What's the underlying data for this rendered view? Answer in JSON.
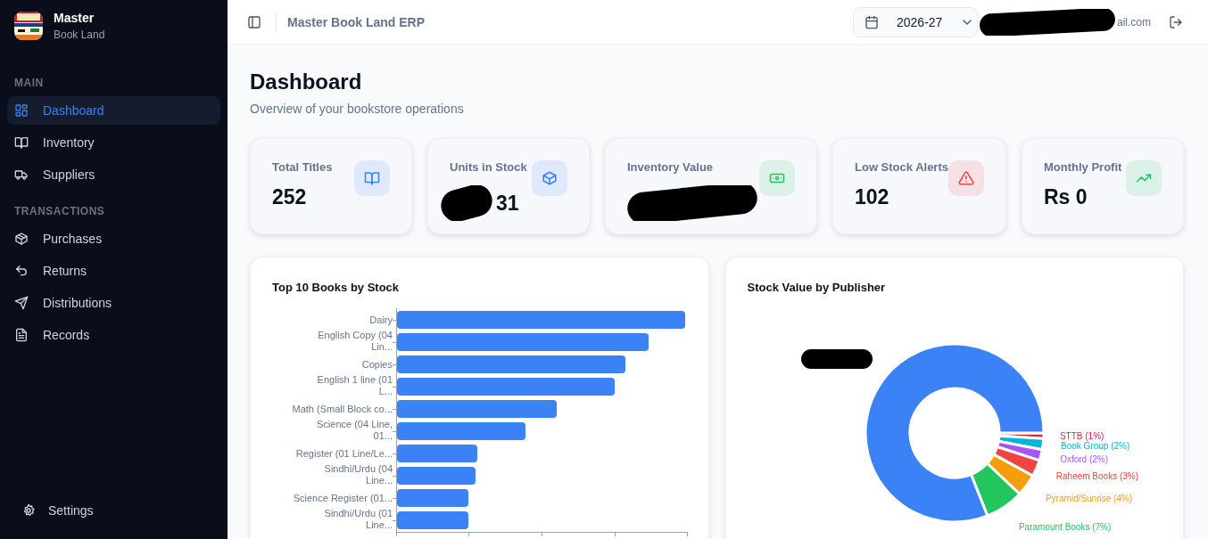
{
  "sidebar": {
    "brand": {
      "name": "Master",
      "subtitle": "Book Land"
    },
    "sections": [
      {
        "heading": "MAIN",
        "items": [
          {
            "label": "Dashboard",
            "selected": true
          },
          {
            "label": "Inventory",
            "selected": false
          },
          {
            "label": "Suppliers",
            "selected": false
          }
        ]
      },
      {
        "heading": "TRANSACTIONS",
        "items": [
          {
            "label": "Purchases",
            "selected": false
          },
          {
            "label": "Returns",
            "selected": false
          },
          {
            "label": "Distributions",
            "selected": false
          },
          {
            "label": "Records",
            "selected": false
          }
        ]
      }
    ],
    "footer": {
      "label": "Settings"
    }
  },
  "header": {
    "title": "Master Book Land ERP",
    "year_select": {
      "value": "2026-27"
    },
    "user_email": "ail.com",
    "email_redacted": true
  },
  "page": {
    "title": "Dashboard",
    "subtitle": "Overview of your bookstore operations"
  },
  "stats": [
    {
      "label": "Total Titles",
      "value": "252",
      "color": "#3b82f6",
      "redacted": false
    },
    {
      "label": "Units in Stock",
      "value": "31",
      "color": "#3b82f6",
      "redacted": true
    },
    {
      "label": "Inventory Value",
      "color": "#22c55e",
      "redacted": true
    },
    {
      "label": "Low Stock Alerts",
      "value": "102",
      "color": "#ef4444",
      "redacted": false
    },
    {
      "label": "Monthly Profit",
      "value": "Rs 0",
      "color": "#22c55e",
      "redacted": false
    }
  ],
  "top_books": {
    "title": "Top 10 Books by Stock",
    "labels": [
      {
        "lines": [
          "Dairy"
        ]
      },
      {
        "lines": [
          "English Copy (04",
          "Lin..."
        ]
      },
      {
        "lines": [
          "Copies"
        ]
      },
      {
        "lines": [
          "English 1 line (01",
          "L..."
        ]
      },
      {
        "lines": [
          "Math (Small Block co..."
        ]
      },
      {
        "lines": [
          "Science (04 Line,",
          "01..."
        ]
      },
      {
        "lines": [
          "Register (01 Line/Le..."
        ]
      },
      {
        "lines": [
          "Sindhi/Urdu (04",
          "Line..."
        ]
      },
      {
        "lines": [
          "Science Register (01..."
        ]
      },
      {
        "lines": [
          "Sindhi/Urdu (01",
          "Line..."
        ]
      }
    ]
  },
  "publisher_value": {
    "title": "Stock Value by Publisher",
    "main_label_redacted": true,
    "slices": [
      {
        "color": "#e11d48"
      },
      {
        "color": "#06b6d4"
      },
      {
        "color": "#a855f7"
      },
      {
        "color": "#ef4444"
      },
      {
        "color": "#f59e0b"
      },
      {
        "color": "#22c55e"
      },
      {
        "color": "#3b82f6"
      }
    ],
    "chart_data": {
      "type": "donut",
      "value_labels": [
        "STTB (1%)",
        "Book Group (2%)",
        "Oxford (2%)",
        "Raheem Books (3%)",
        "Pyramid/Sunrise (4%)",
        "Paramount Books (7%)",
        null
      ],
      "values": [
        1,
        2,
        2,
        3,
        4,
        7,
        81
      ]
    }
  }
}
